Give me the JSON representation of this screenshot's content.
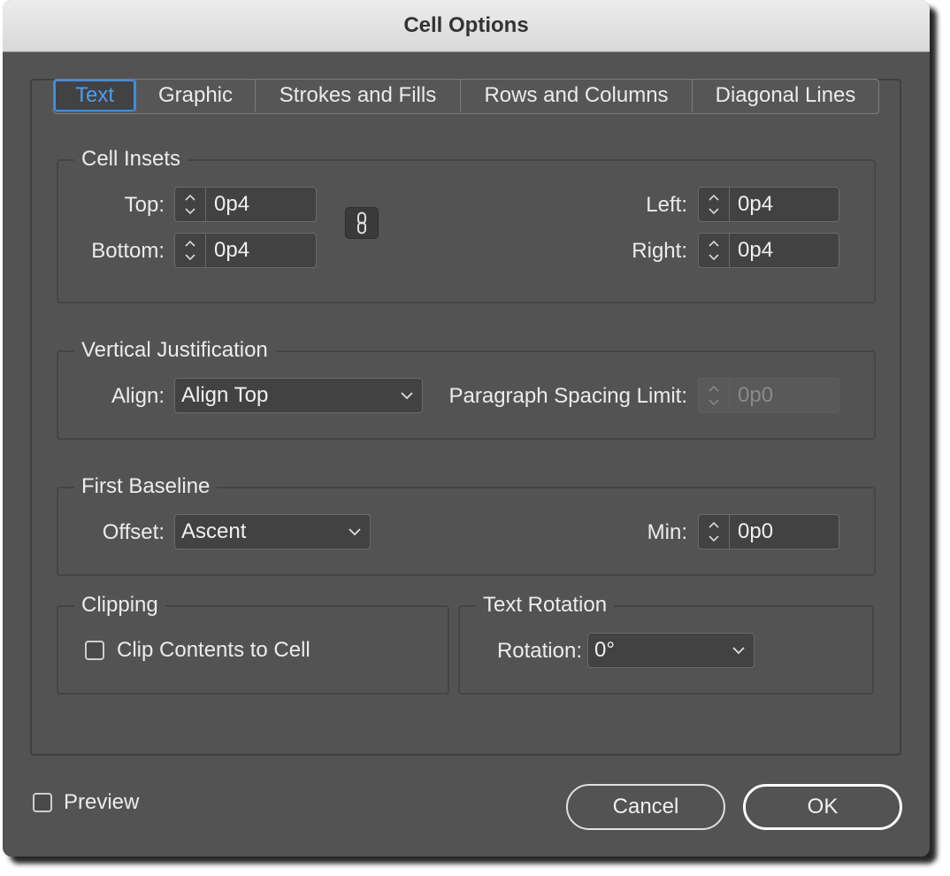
{
  "window": {
    "title": "Cell Options"
  },
  "tabs": [
    {
      "label": "Text",
      "active": true
    },
    {
      "label": "Graphic"
    },
    {
      "label": "Strokes and Fills"
    },
    {
      "label": "Rows and Columns"
    },
    {
      "label": "Diagonal Lines"
    }
  ],
  "cell_insets": {
    "legend": "Cell Insets",
    "top": {
      "label": "Top:",
      "value": "0p4"
    },
    "bottom": {
      "label": "Bottom:",
      "value": "0p4"
    },
    "left": {
      "label": "Left:",
      "value": "0p4"
    },
    "right": {
      "label": "Right:",
      "value": "0p4"
    },
    "link_icon": "chain-link-icon"
  },
  "vertical_justification": {
    "legend": "Vertical Justification",
    "align_label": "Align:",
    "align_value": "Align Top",
    "paragraph_spacing_label": "Paragraph Spacing Limit:",
    "paragraph_spacing_value": "0p0"
  },
  "first_baseline": {
    "legend": "First Baseline",
    "offset_label": "Offset:",
    "offset_value": "Ascent",
    "min_label": "Min:",
    "min_value": "0p0"
  },
  "clipping": {
    "legend": "Clipping",
    "checkbox_label": "Clip Contents to Cell",
    "checked": false
  },
  "text_rotation": {
    "legend": "Text Rotation",
    "rotation_label": "Rotation:",
    "rotation_value": "0°"
  },
  "footer": {
    "preview_label": "Preview",
    "preview_checked": false,
    "cancel_label": "Cancel",
    "ok_label": "OK"
  },
  "colors": {
    "dialog_bg": "#535353",
    "field_bg": "#424242",
    "accent": "#3b8fe8"
  }
}
